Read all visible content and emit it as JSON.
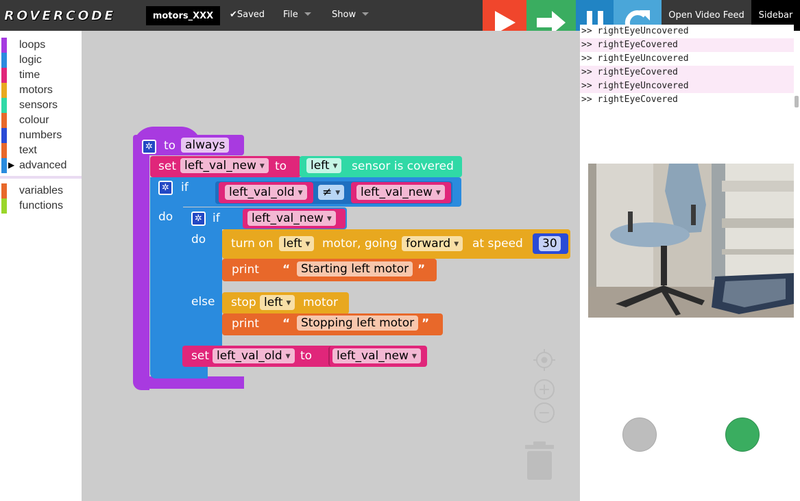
{
  "header": {
    "logo": "ROVERCODE",
    "filename": "motors_XXX",
    "saved": "✔Saved",
    "menus": {
      "file": "File",
      "show": "Show"
    },
    "controls": [
      "run-icon",
      "step-icon",
      "pause-icon",
      "reset-icon"
    ],
    "open_video_feed": "Open Video Feed",
    "sidebar": "Sidebar"
  },
  "toolbox": {
    "categories": [
      {
        "label": "loops",
        "color": "#a53ae0"
      },
      {
        "label": "logic",
        "color": "#2a8bde"
      },
      {
        "label": "time",
        "color": "#e0267a"
      },
      {
        "label": "motors",
        "color": "#e8a81f"
      },
      {
        "label": "sensors",
        "color": "#30d9a6"
      },
      {
        "label": "colour",
        "color": "#e8682a"
      },
      {
        "label": "numbers",
        "color": "#2a4bd6"
      },
      {
        "label": "text",
        "color": "#e8682a"
      },
      {
        "label": "advanced",
        "color": "#2a8bde"
      }
    ],
    "extra": [
      {
        "label": "variables",
        "color": "#e8682a"
      },
      {
        "label": "functions",
        "color": "#9ad62a"
      }
    ]
  },
  "blocks": {
    "to": "to",
    "always": "always",
    "set": "set",
    "to_kw": "to",
    "left_val_new": "left_val_new",
    "left_val_old": "left_val_old",
    "left": "left",
    "sensor_is_covered": "sensor is covered",
    "if": "if",
    "do": "do",
    "else": "else",
    "neq": "≠",
    "turn_on": "turn on",
    "motor_going": "motor, going",
    "forward": "forward",
    "at_speed": "at speed",
    "speed": "30",
    "print": "print",
    "open_quote": "“",
    "close_quote": "”",
    "starting_msg": "Starting left motor",
    "stopping_msg": "Stopping left motor",
    "stop": "stop",
    "motor": "motor"
  },
  "workspace_controls": {
    "recenter": "crosshair-icon",
    "zoom_in": "+",
    "zoom_out": "−",
    "trash": "trash-icon"
  },
  "console": {
    "lines": [
      ">> rightEyeUncovered",
      ">> rightEyeCovered",
      ">> rightEyeUncovered",
      ">> rightEyeCovered",
      ">> rightEyeUncovered",
      ">> rightEyeCovered"
    ]
  },
  "indicators": {
    "left_eye_color": "#bdbdbd",
    "right_eye_color": "#3aad60"
  }
}
